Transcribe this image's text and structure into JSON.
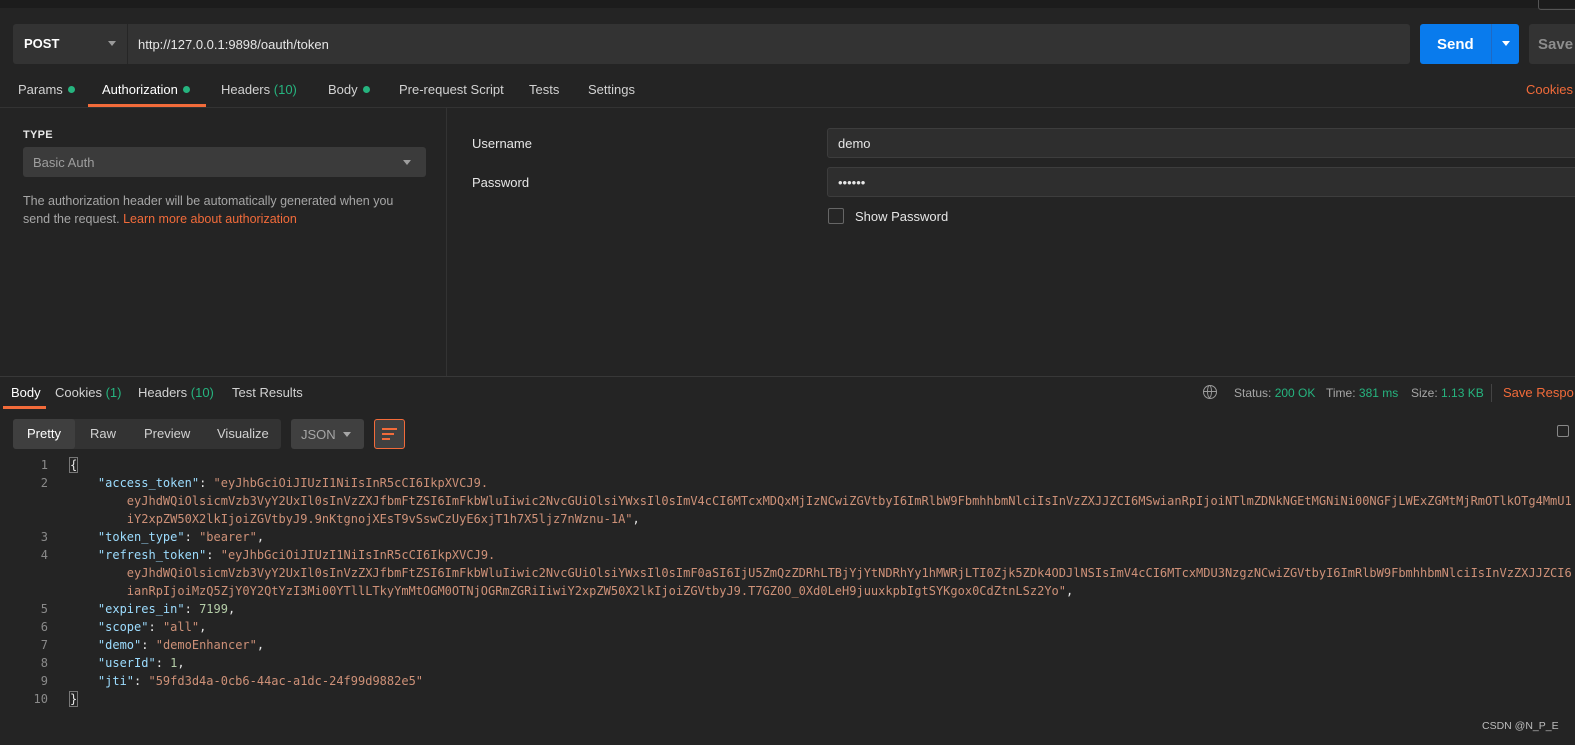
{
  "request": {
    "method": "POST",
    "url": "http://127.0.0.1:9898/oauth/token",
    "send_label": "Send",
    "save_label": "Save"
  },
  "request_tabs": [
    {
      "label": "Params",
      "dot": true
    },
    {
      "label": "Authorization",
      "dot": true,
      "active": true
    },
    {
      "label": "Headers",
      "count": "(10)"
    },
    {
      "label": "Body",
      "dot": true
    },
    {
      "label": "Pre-request Script"
    },
    {
      "label": "Tests"
    },
    {
      "label": "Settings"
    }
  ],
  "cookies_link": "Cookies",
  "auth": {
    "type_label": "TYPE",
    "type_value": "Basic Auth",
    "description": "The authorization header will be automatically generated when you send the request.",
    "learn_more": "Learn more about authorization",
    "username_label": "Username",
    "username_value": "demo",
    "password_label": "Password",
    "password_value": "••••••",
    "show_password_label": "Show Password"
  },
  "response_tabs": [
    {
      "label": "Body",
      "active": true
    },
    {
      "label": "Cookies",
      "count": "(1)"
    },
    {
      "label": "Headers",
      "count": "(10)"
    },
    {
      "label": "Test Results"
    }
  ],
  "status": {
    "status_label": "Status:",
    "status_value": "200 OK",
    "time_label": "Time:",
    "time_value": "381 ms",
    "size_label": "Size:",
    "size_value": "1.13 KB",
    "save_response": "Save Respo"
  },
  "view_modes": [
    "Pretty",
    "Raw",
    "Preview",
    "Visualize"
  ],
  "format": "JSON",
  "code_lines": [
    {
      "n": "1",
      "parts": [
        [
          "p",
          "{"
        ]
      ]
    },
    {
      "n": "2",
      "parts": [
        [
          "p",
          "    "
        ],
        [
          "k",
          "\"access_token\""
        ],
        [
          "p",
          ": "
        ],
        [
          "s",
          "\"eyJhbGciOiJIUzI1NiIsInR5cCI6IkpXVCJ9."
        ]
      ]
    },
    {
      "n": "",
      "parts": [
        [
          "s",
          "        eyJhdWQiOlsicmVzb3VyY2UxIl0sInVzZXJfbmFtZSI6ImFkbWluIiwic2NvcGUiOlsiYWxsIl0sImV4cCI6MTcxMDQxMjIzNCwiZGVtbyI6ImRlbW9FbmhhbmNlciIsInVzZXJJZCI6MSwianRpIjoiNTlmZDNkNGEtMGNiNi00NGFjLWExZGMtMjRmOTlkOTg4MmU1"
        ]
      ]
    },
    {
      "n": "",
      "parts": [
        [
          "s",
          "        iY2xpZW50X2lkIjoiZGVtbyJ9.9nKtgnojXEsT9vSswCzUyE6xjT1h7X5ljz7nWznu-1A\""
        ],
        [
          "p",
          ","
        ]
      ]
    },
    {
      "n": "3",
      "parts": [
        [
          "p",
          "    "
        ],
        [
          "k",
          "\"token_type\""
        ],
        [
          "p",
          ": "
        ],
        [
          "s",
          "\"bearer\""
        ],
        [
          "p",
          ","
        ]
      ]
    },
    {
      "n": "4",
      "parts": [
        [
          "p",
          "    "
        ],
        [
          "k",
          "\"refresh_token\""
        ],
        [
          "p",
          ": "
        ],
        [
          "s",
          "\"eyJhbGciOiJIUzI1NiIsInR5cCI6IkpXVCJ9."
        ]
      ]
    },
    {
      "n": "",
      "parts": [
        [
          "s",
          "        eyJhdWQiOlsicmVzb3VyY2UxIl0sInVzZXJfbmFtZSI6ImFkbWluIiwic2NvcGUiOlsiYWxsIl0sImF0aSI6IjU5ZmQzZDRhLTBjYjYtNDRhYy1hMWRjLTI0Zjk5ZDk4ODJlNSIsImV4cCI6MTcxMDU3NzgzNCwiZGVtbyI6ImRlbW9FbmhhbmNlciIsInVzZXJJZCI6"
        ]
      ]
    },
    {
      "n": "",
      "parts": [
        [
          "s",
          "        ianRpIjoiMzQ5ZjY0Y2QtYzI3Mi00YTllLTkyYmMtOGM0OTNjOGRmZGRiIiwiY2xpZW50X2lkIjoiZGVtbyJ9.T7GZ0O_0Xd0LeH9juuxkpbIgtSYKgox0CdZtnLSz2Yo\""
        ],
        [
          "p",
          ","
        ]
      ]
    },
    {
      "n": "5",
      "parts": [
        [
          "p",
          "    "
        ],
        [
          "k",
          "\"expires_in\""
        ],
        [
          "p",
          ": "
        ],
        [
          "n",
          "7199"
        ],
        [
          "p",
          ","
        ]
      ]
    },
    {
      "n": "6",
      "parts": [
        [
          "p",
          "    "
        ],
        [
          "k",
          "\"scope\""
        ],
        [
          "p",
          ": "
        ],
        [
          "s",
          "\"all\""
        ],
        [
          "p",
          ","
        ]
      ]
    },
    {
      "n": "7",
      "parts": [
        [
          "p",
          "    "
        ],
        [
          "k",
          "\"demo\""
        ],
        [
          "p",
          ": "
        ],
        [
          "s",
          "\"demoEnhancer\""
        ],
        [
          "p",
          ","
        ]
      ]
    },
    {
      "n": "8",
      "parts": [
        [
          "p",
          "    "
        ],
        [
          "k",
          "\"userId\""
        ],
        [
          "p",
          ": "
        ],
        [
          "n",
          "1"
        ],
        [
          "p",
          ","
        ]
      ]
    },
    {
      "n": "9",
      "parts": [
        [
          "p",
          "    "
        ],
        [
          "k",
          "\"jti\""
        ],
        [
          "p",
          ": "
        ],
        [
          "s",
          "\"59fd3d4a-0cb6-44ac-a1dc-24f99d9882e5\""
        ]
      ]
    },
    {
      "n": "10",
      "parts": [
        [
          "p",
          "}"
        ]
      ]
    }
  ],
  "watermark": "CSDN @N_P_E"
}
